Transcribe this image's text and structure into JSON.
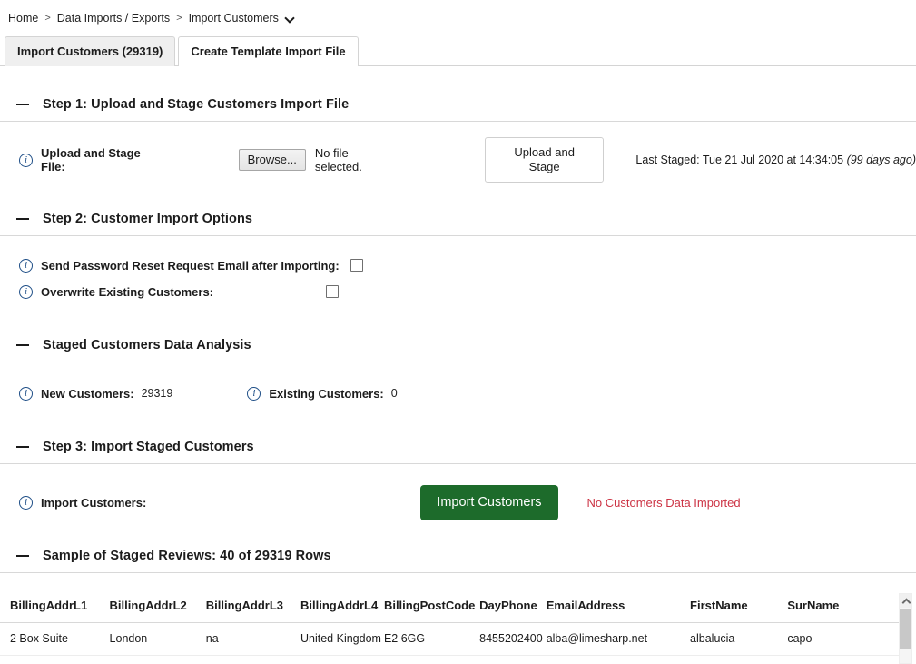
{
  "breadcrumb": {
    "items": [
      "Home",
      "Data Imports / Exports",
      "Import Customers"
    ],
    "separator": ">"
  },
  "tabs": [
    {
      "label": "Import Customers (29319)",
      "active": true
    },
    {
      "label": "Create Template Import File",
      "active": false
    }
  ],
  "step1": {
    "title": "Step 1: Upload and Stage Customers Import File",
    "label": "Upload and Stage File:",
    "browse_label": "Browse...",
    "no_file_text": "No file selected.",
    "upload_button": "Upload and Stage",
    "last_staged_prefix": "Last Staged: Tue 21 Jul 2020 at 14:34:05",
    "last_staged_ago": "(99 days ago)"
  },
  "step2": {
    "title": "Step 2: Customer Import Options",
    "options": [
      {
        "label": "Send Password Reset Request Email after Importing:",
        "checked": false
      },
      {
        "label": "Overwrite Existing Customers:",
        "checked": false
      }
    ]
  },
  "analysis": {
    "title": "Staged Customers Data Analysis",
    "new_label": "New Customers:",
    "new_value": "29319",
    "existing_label": "Existing Customers:",
    "existing_value": "0"
  },
  "step3": {
    "title": "Step 3: Import Staged Customers",
    "label": "Import Customers:",
    "button": "Import Customers",
    "status": "No Customers Data Imported",
    "button_color": "#1d6b2b",
    "status_color": "#cc3344"
  },
  "sample": {
    "title": "Sample of Staged Reviews: 40 of 29319 Rows",
    "columns": [
      "BillingAddrL1",
      "BillingAddrL2",
      "BillingAddrL3",
      "BillingAddrL4",
      "BillingPostCode",
      "DayPhone",
      "EmailAddress",
      "FirstName",
      "SurName"
    ],
    "rows": [
      [
        "2 Box Suite",
        "London",
        "na",
        "United Kingdom",
        "E2 6GG",
        "8455202400",
        "alba@limesharp.net",
        "albalucia",
        "capo"
      ]
    ]
  }
}
